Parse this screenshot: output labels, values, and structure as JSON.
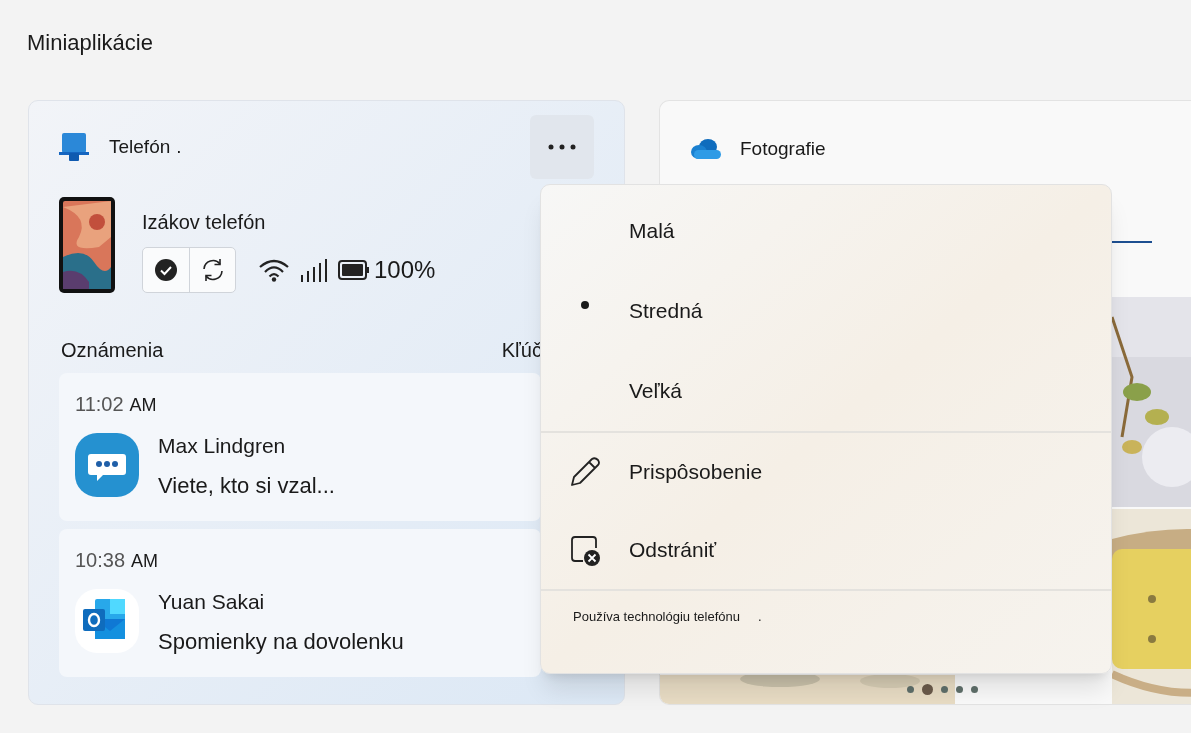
{
  "page": {
    "title": "Miniaplikácie"
  },
  "phone_widget": {
    "title": "Telefón",
    "title_mark": ".",
    "device_name": "Izákov telefón",
    "battery": "100%",
    "device_buttons": [
      {
        "kind": "check"
      },
      {
        "kind": "sync"
      }
    ],
    "notifications_heading": "Oznámenia",
    "column_2_heading": "Kľúč",
    "notifications": [
      {
        "time": "11:02",
        "period": "AM",
        "kind": "chat",
        "sender": "Max Lindgren",
        "message": "Viete, kto si vzal..."
      },
      {
        "time": "10:38",
        "period": "AM",
        "kind": "mail",
        "sender": "Yuan Sakai",
        "message": "Spomienky na dovolenku"
      }
    ]
  },
  "photos_widget": {
    "title": "Fotografie",
    "pages": [
      {
        "selected": false
      },
      {
        "selected": true
      },
      {
        "selected": false
      },
      {
        "selected": false
      },
      {
        "selected": false
      }
    ]
  },
  "context_menu": {
    "items": [
      {
        "kind": "size",
        "label": "Malá",
        "selected": false
      },
      {
        "kind": "size",
        "label": "Stredná",
        "selected": true
      },
      {
        "kind": "size",
        "label": "Veľká",
        "selected": false
      },
      {
        "kind": "divider"
      },
      {
        "kind": "edit",
        "label": "Prispôsobenie"
      },
      {
        "kind": "remove",
        "label": "Odstrániť"
      },
      {
        "kind": "divider"
      }
    ],
    "footer": "Používa technológiu telefónu",
    "footer_mark": "."
  }
}
